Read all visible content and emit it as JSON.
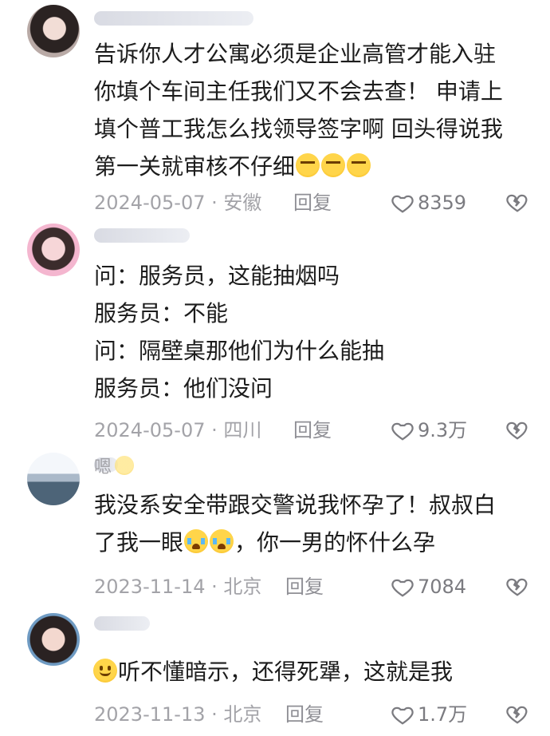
{
  "comments": [
    {
      "avatar": "avatar-girl-icon",
      "text": "告诉你人才公寓必须是企业高管才能入驻\n你填个车间主任我们又不会去查！ 申请上\n填个普工我怎么找领导签字啊 回头得说我\n第一关就审核不仔细",
      "emojis": [
        "smirk-emoji-icon",
        "smirk-emoji-icon",
        "smirk-emoji-icon"
      ],
      "date": "2024-05-07 · 安徽",
      "reply": "回复",
      "likes": "8359"
    },
    {
      "avatar": "avatar-girl-icon",
      "text": "问：服务员，这能抽烟吗\n服务员：不能\n问：隔壁桌那他们为什么能抽\n服务员：他们没问",
      "date": "2024-05-07 · 四川",
      "reply": "回复",
      "likes": "9.3万"
    },
    {
      "avatar": "avatar-sea-icon",
      "username": "嗯",
      "text_line1": "我没系安全带跟交警说我怀孕了！叔叔白",
      "text_line2_a": "了我一眼",
      "text_line2_b": "，你一男的怀什么孕",
      "date": "2023-11-14 · 北京",
      "reply": "回复",
      "likes": "7084"
    },
    {
      "avatar": "avatar-girl-icon",
      "text": "听不懂暗示，还得死犟，这就是我",
      "date": "2023-11-13 · 北京",
      "reply": "回复",
      "likes": "1.7万"
    }
  ],
  "colors": {
    "text": "#1c1c1c",
    "meta": "#a3a3a8",
    "emoji": "#ffd54a"
  }
}
